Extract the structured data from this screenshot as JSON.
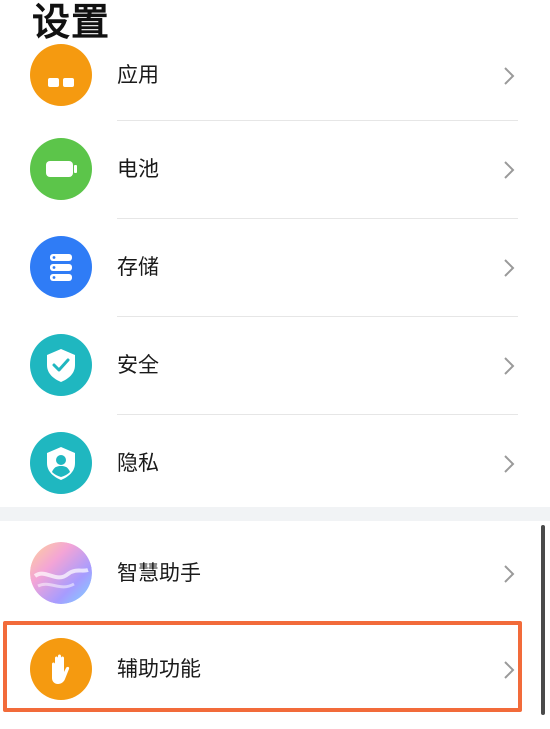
{
  "header": {
    "title": "设置"
  },
  "group1": {
    "items": [
      {
        "label": "应用",
        "icon": "apps-icon",
        "color": "#f59a10"
      },
      {
        "label": "电池",
        "icon": "battery-icon",
        "color": "#5cc54a"
      },
      {
        "label": "存储",
        "icon": "storage-icon",
        "color": "#2f7cf6"
      },
      {
        "label": "安全",
        "icon": "shield-check-icon",
        "color": "#1fb7c0"
      },
      {
        "label": "隐私",
        "icon": "privacy-icon",
        "color": "#1fb7c0"
      }
    ]
  },
  "group2": {
    "items": [
      {
        "label": "智慧助手",
        "icon": "assistant-icon",
        "color": "#c8a0ff"
      },
      {
        "label": "辅助功能",
        "icon": "hand-icon",
        "color": "#f59a10"
      }
    ]
  },
  "highlight_color": "#f26b3a"
}
